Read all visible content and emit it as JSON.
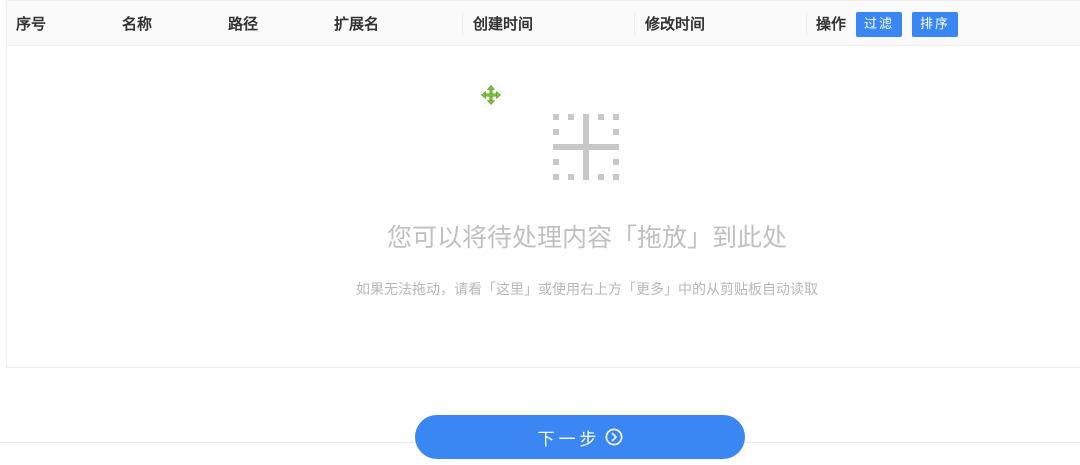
{
  "table": {
    "columns": [
      "序号",
      "名称",
      "路径",
      "扩展名",
      "创建时间",
      "修改时间"
    ],
    "action": {
      "label": "操作",
      "filter_label": "过滤",
      "sort_label": "排序"
    }
  },
  "dropzone": {
    "icon": "drop-target-icon",
    "cursor_icon": "move-cursor-icon",
    "title": "您可以将待处理内容「拖放」到此处",
    "subtitle": "如果无法拖动，请看「这里」或使用右上方「更多」中的从剪贴板自动读取"
  },
  "footer": {
    "next_label": "下一步",
    "next_icon": "circle-arrow-right-icon"
  },
  "colors": {
    "accent": "#3a86f3",
    "cursor": "#7cc53a",
    "muted_text": "#c0c0c0"
  }
}
